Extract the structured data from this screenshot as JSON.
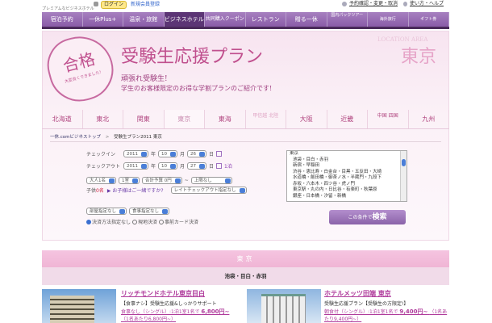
{
  "header": {
    "tagline": "プレミアムなビジネスホテル",
    "login": "ログイン",
    "register": "新規会員登録",
    "reservation_link": "予約確認・変更・取消",
    "help_link": "使い方・ヘルプ"
  },
  "nav": [
    {
      "label": "宿泊予約"
    },
    {
      "label": "一休Plus+"
    },
    {
      "label": "温泉・旅館"
    },
    {
      "label": "ビジネスホテル",
      "active": true
    },
    {
      "label": "共同購入クーポン"
    },
    {
      "label": "レストラン"
    },
    {
      "label": "贈る一休"
    },
    {
      "label": "国内パックツアー"
    },
    {
      "label": "海外旅行"
    },
    {
      "label": "ギフト券"
    }
  ],
  "banner": {
    "badge_main": "合格",
    "badge_sub": "大変良くできました!",
    "title": "受験生応援プラン",
    "subtitle": "頑張れ受験生!",
    "description": "学生のお客様限定のお得な学割プランのご紹介です!",
    "location_label": "LOCATION AREA",
    "location": "東京"
  },
  "regions": [
    {
      "label": "北海道"
    },
    {
      "label": "東北"
    },
    {
      "label": "関東"
    },
    {
      "label": "東京",
      "active": true
    },
    {
      "label": "東海"
    },
    {
      "label": "甲信越 北陸",
      "dim": true
    },
    {
      "label": "大阪"
    },
    {
      "label": "近畿"
    },
    {
      "label": "中国 四国"
    },
    {
      "label": "九州"
    }
  ],
  "breadcrumb": {
    "home": "一休.comビジネストップ",
    "sep": ">",
    "current": "受験生プラン2011 東京"
  },
  "form": {
    "checkin_label": "チェックイン",
    "checkout_label": "チェックアウト",
    "checkin": {
      "year": "2011",
      "month": "10",
      "day": "26"
    },
    "checkout": {
      "year": "2011",
      "month": "10",
      "day": "27"
    },
    "year_unit": "年",
    "month_unit": "月",
    "day_unit": "日",
    "nights": "1泊",
    "adults": "大人1名",
    "rooms": "1室",
    "budget_min": "合計予算 0円",
    "tilde": "~",
    "budget_max": "上限なし",
    "children_prefix": "子供",
    "children_count": "0名",
    "children_link": "▶ お子様はご一緒ですか?",
    "late_checkout": "レイトチェックアウト指定なし",
    "room_type": "部屋指定なし",
    "meal": "食事指定なし",
    "payment_options": [
      "決済方法指定なし",
      "現地決済",
      "事前カード決済"
    ],
    "search_prefix": "この条件で",
    "search_label": "検索"
  },
  "area_list": {
    "header": "東京",
    "items": [
      "池袋・目白・赤羽",
      "新宿・早稲田",
      "渋谷・恵比寿・白金台・目黒・五反田・大崎",
      "水道橋・飯田橋・御茶ノ水・半蔵門・九段下",
      "赤坂・六本木・四ツ谷・虎ノ門",
      "東京駅・丸の内・日比谷・有楽町・秋葉原",
      "銀座・日本橋・汐留・新橋"
    ]
  },
  "results": {
    "region": "東京",
    "area": "池袋・目白・赤羽",
    "hotels": [
      {
        "name": "リッチモンドホテル東京目白",
        "desc": "【食事ナシ】受験生応援&しっかりサポート",
        "price_text": "食事なし（シングル）:1泊1室1名で",
        "price": "6,800円~",
        "per_person": "（1名あたり6,800円~）"
      },
      {
        "name": "ホテルメッツ田端 東京",
        "desc": "受験生応援プラン【受験生の方限定!】",
        "price_text": "朝食付（シングル）:1泊1室1名で",
        "price": "9,400円~",
        "per_person": "（1名あたり9,400円~）"
      }
    ]
  },
  "colors": {
    "accent": "#b03c9c",
    "nav": "#8a5ca8",
    "pink": "#f0b5d5"
  }
}
